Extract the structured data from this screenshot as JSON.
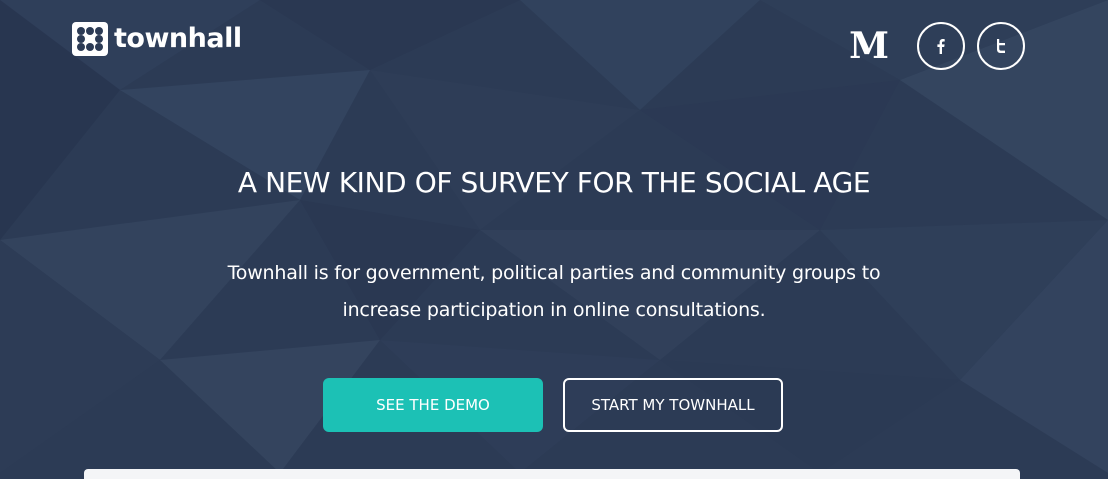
{
  "brand": {
    "logo_text": "townhall",
    "logo_icon": "townhall-logo-icon"
  },
  "social": {
    "medium_label": "M",
    "medium_icon": "medium-icon",
    "facebook_icon": "facebook-icon",
    "facebook_glyph": "f",
    "twitter_icon": "twitter-icon"
  },
  "hero": {
    "headline": "A NEW KIND OF SURVEY FOR THE SOCIAL AGE",
    "subtext_line1": "Townhall is for government, political parties and community groups to",
    "subtext_line2": "increase participation in online consultations."
  },
  "buttons": {
    "demo_label": "SEE THE DEMO",
    "start_label": "START MY TOWNHALL"
  },
  "colors": {
    "background": "#2c3b55",
    "accent": "#1cc1b5",
    "text": "#ffffff"
  }
}
